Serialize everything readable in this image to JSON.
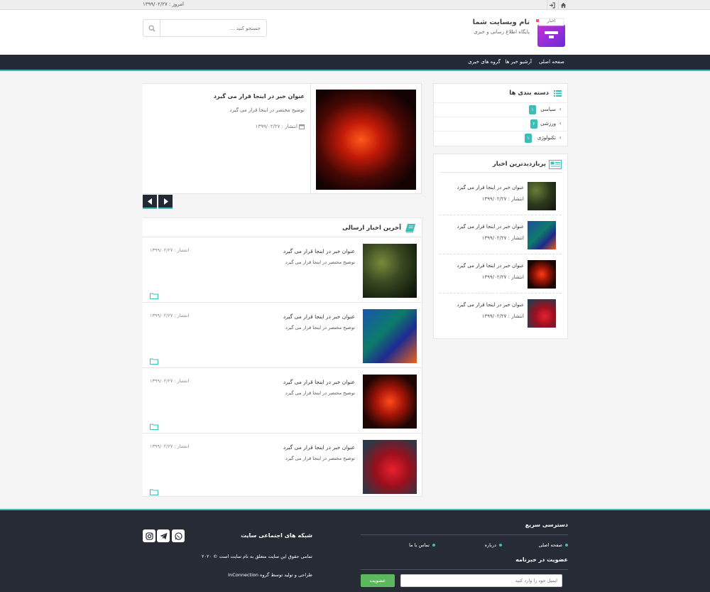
{
  "topbar": {
    "date_text": "امروز : ۱۳۹۹/۰۲/۲۷"
  },
  "header": {
    "site_name": "نام وبسایت شما",
    "site_tagline": "پایگاه اطلاع رسانی و خبری",
    "logo_text": "اخبار",
    "search_placeholder": "جستجو کنید ..."
  },
  "nav": {
    "items": [
      "صفحه اصلی",
      "آرشیو خبر ها",
      "گروه های خبری"
    ]
  },
  "slider": {
    "title": "عنوان خبر در اینجا قرار می گیرد",
    "summary": "توضیح مختصر در اینجا قرار می گیرد",
    "date": "انتشار : ۱۳۹۹/۰۲/۲۷"
  },
  "categories": {
    "title": "دسته بندی ها",
    "items": [
      {
        "label": "سیاسی",
        "count": "۱"
      },
      {
        "label": "ورزشی",
        "count": "۲"
      },
      {
        "label": "تکنولوژی",
        "count": "۱"
      }
    ]
  },
  "popular": {
    "title": "پربازدیدترین اخبار",
    "items": [
      {
        "title": "عنوان خبر در اینجا قرار می گیرد",
        "date": "انتشار : ۱۳۹۹/۰۲/۲۷"
      },
      {
        "title": "عنوان خبر در اینجا قرار می گیرد",
        "date": "انتشار : ۱۳۹۹/۰۲/۲۷"
      },
      {
        "title": "عنوان خبر در اینجا قرار می گیرد",
        "date": "انتشار : ۱۳۹۹/۰۲/۲۷"
      },
      {
        "title": "عنوان خبر در اینجا قرار می گیرد",
        "date": "انتشار : ۱۳۹۹/۰۲/۲۷"
      }
    ]
  },
  "latest": {
    "title": "آخرین اخبار ارسالی",
    "items": [
      {
        "title": "عنوان خبر در اینجا قرار می گیرد",
        "summary": "توضیح مختصر در اینجا قرار می گیرد",
        "date": "انتشار : ۱۳۹۹/۰۲/۲۷"
      },
      {
        "title": "عنوان خبر در اینجا قرار می گیرد",
        "summary": "توضیح مختصر در اینجا قرار می گیرد",
        "date": "انتشار : ۱۳۹۹/۰۲/۲۷"
      },
      {
        "title": "عنوان خبر در اینجا قرار می گیرد",
        "summary": "توضیح مختصر در اینجا قرار می گیرد",
        "date": "انتشار : ۱۳۹۹/۰۲/۲۷"
      },
      {
        "title": "عنوان خبر در اینجا قرار می گیرد",
        "summary": "توضیح مختصر در اینجا قرار می گیرد",
        "date": "انتشار : ۱۳۹۹/۰۲/۲۷"
      }
    ]
  },
  "footer": {
    "quick_access_title": "دسترسی سریع",
    "links": [
      "صفحه اصلی",
      "درباره",
      "تماس با ما"
    ],
    "newsletter_title": "عضویت در خبرنامه",
    "email_placeholder": "ایمیل خود را وارد کنید",
    "subscribe_label": "عضویت",
    "social_title": "شبکه های اجتماعی سایت",
    "copyright": "تمامی حقوق این سایت متعلق به نام سایت است © ۲۰۲۰",
    "credit": "طراحی و تولید توسط گروه InConnection"
  },
  "colors": {
    "accent": "#3dbdb5",
    "dark": "#232a36",
    "subscribe": "#5cb85c"
  }
}
